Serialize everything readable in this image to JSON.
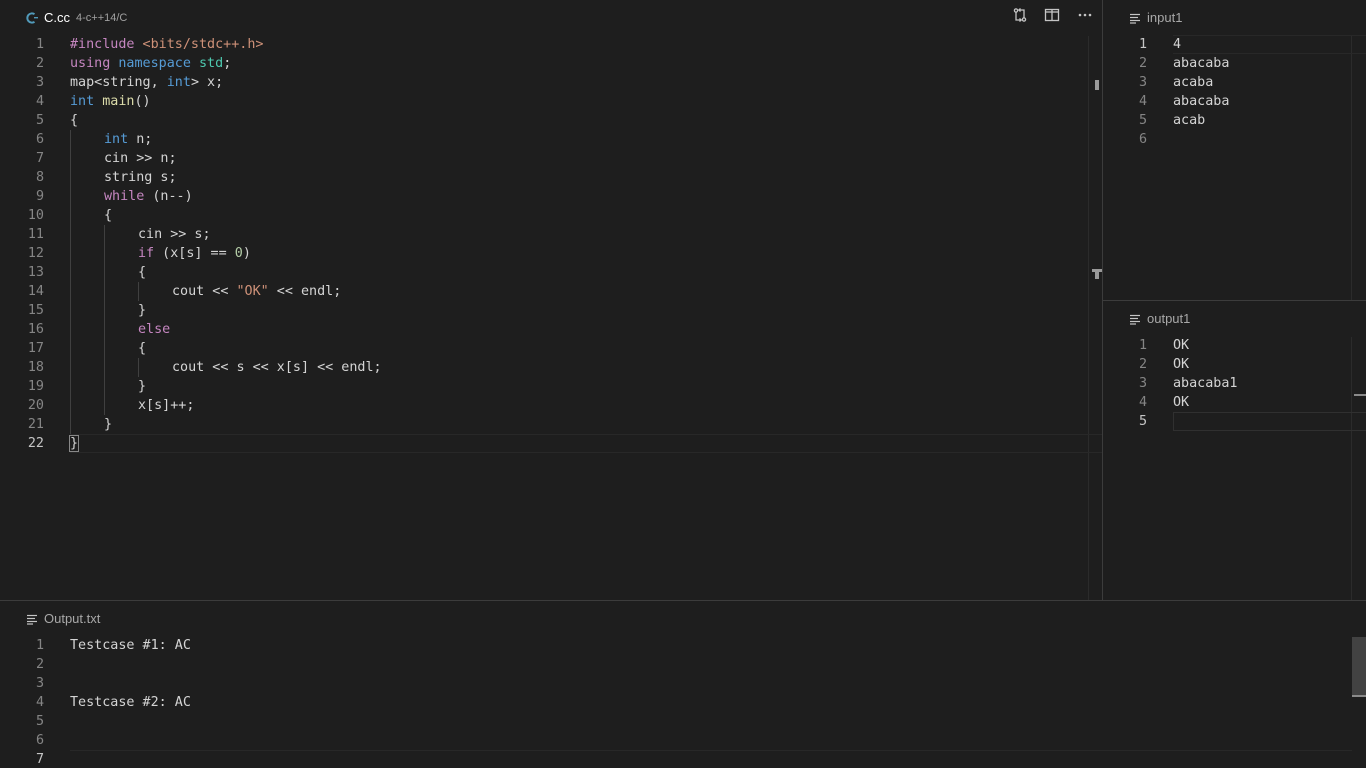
{
  "main_editor": {
    "tab_title": "C.cc",
    "tab_subtitle": "4-c++14/C",
    "lines": [
      {
        "n": "1"
      },
      {
        "n": "2"
      },
      {
        "n": "3"
      },
      {
        "n": "4"
      },
      {
        "n": "5"
      },
      {
        "n": "6"
      },
      {
        "n": "7"
      },
      {
        "n": "8"
      },
      {
        "n": "9"
      },
      {
        "n": "10"
      },
      {
        "n": "11"
      },
      {
        "n": "12"
      },
      {
        "n": "13"
      },
      {
        "n": "14"
      },
      {
        "n": "15"
      },
      {
        "n": "16"
      },
      {
        "n": "17"
      },
      {
        "n": "18"
      },
      {
        "n": "19"
      },
      {
        "n": "20"
      },
      {
        "n": "21"
      },
      {
        "n": "22"
      }
    ],
    "code": {
      "l1_a": "#include",
      "l1_b": " <bits/stdc++.h>",
      "l2_a": "using",
      "l2_b": " namespace",
      "l2_c": " std",
      "l2_d": ";",
      "l3_a": "map<string, ",
      "l3_b": "int",
      "l3_c": "> x;",
      "l4_a": "int",
      "l4_b": " main",
      "l4_c": "()",
      "l5": "{",
      "l6_a": "int",
      "l6_b": " n;",
      "l7": "cin >> n;",
      "l8": "string s;",
      "l9_a": "while",
      "l9_b": " (n--)",
      "l10": "{",
      "l11": "cin >> s;",
      "l12_a": "if",
      "l12_b": " (x[s] == ",
      "l12_c": "0",
      "l12_d": ")",
      "l13": "{",
      "l14_a": "cout << ",
      "l14_b": "\"OK\"",
      "l14_c": " << endl;",
      "l15": "}",
      "l16": "else",
      "l17": "{",
      "l18": "cout << s << x[s] << endl;",
      "l19": "}",
      "l20": "x[s]++;",
      "l21": "}",
      "l22": "}"
    }
  },
  "input_pane": {
    "title": "input1",
    "lines": [
      {
        "n": "1",
        "text": "4"
      },
      {
        "n": "2",
        "text": "abacaba"
      },
      {
        "n": "3",
        "text": "acaba"
      },
      {
        "n": "4",
        "text": "abacaba"
      },
      {
        "n": "5",
        "text": "acab"
      },
      {
        "n": "6",
        "text": ""
      }
    ]
  },
  "output_pane": {
    "title": "output1",
    "lines": [
      {
        "n": "1",
        "text": "OK"
      },
      {
        "n": "2",
        "text": "OK"
      },
      {
        "n": "3",
        "text": "abacaba1"
      },
      {
        "n": "4",
        "text": "OK"
      },
      {
        "n": "5",
        "text": ""
      }
    ]
  },
  "result_pane": {
    "title": "Output.txt",
    "lines": [
      {
        "n": "1",
        "text": "Testcase #1: AC"
      },
      {
        "n": "2",
        "text": ""
      },
      {
        "n": "3",
        "text": ""
      },
      {
        "n": "4",
        "text": "Testcase #2: AC"
      },
      {
        "n": "5",
        "text": ""
      },
      {
        "n": "6",
        "text": ""
      },
      {
        "n": "7",
        "text": ""
      }
    ]
  },
  "icons": {
    "file": "cpp-file-icon",
    "toolbar": [
      "compare-changes-icon",
      "split-editor-icon",
      "more-actions-icon"
    ],
    "pane": "text-lines-icon"
  },
  "colors": {
    "background": "#1e1e1e",
    "keyword_purple": "#c586c0",
    "keyword_blue": "#569cd6",
    "string": "#ce9178",
    "number": "#b5cea8",
    "type": "#4ec9b0",
    "function": "#dcdcaa",
    "line_number": "#858585"
  }
}
